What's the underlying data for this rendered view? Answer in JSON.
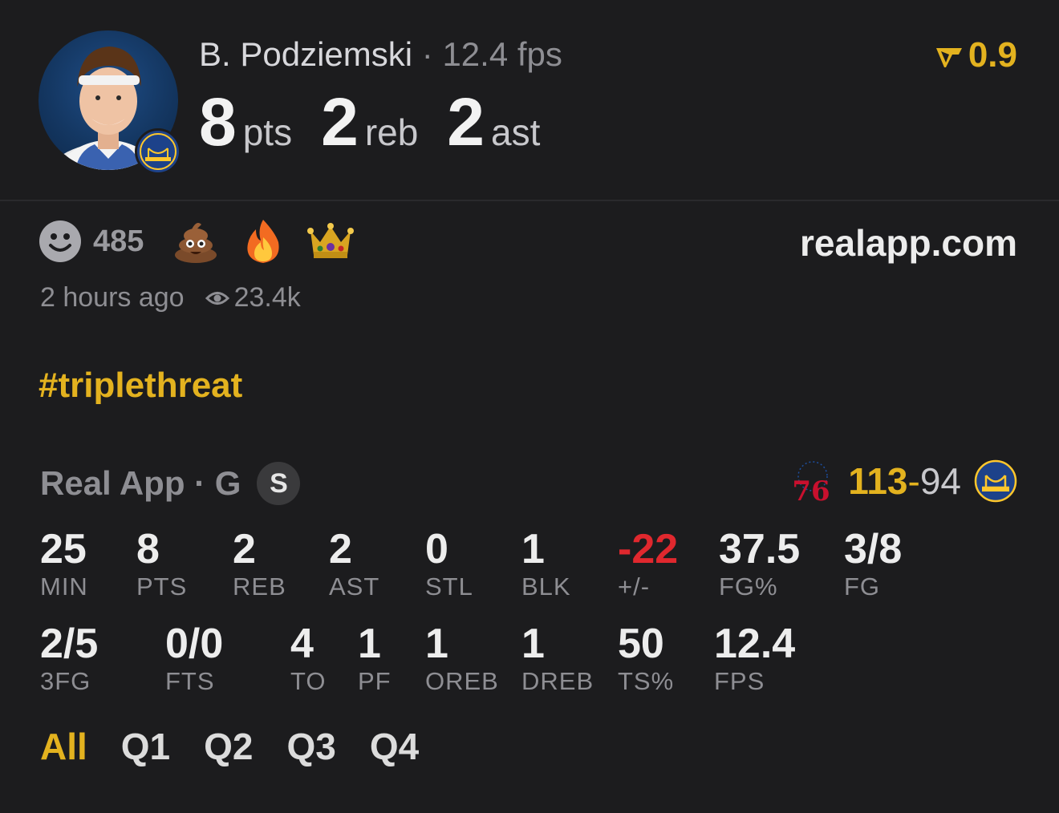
{
  "header": {
    "player_name": "B. Podziemski",
    "separator": "·",
    "fps_text": "12.4 fps",
    "rating_icon": "real-logo-icon",
    "rating": "0.9",
    "stats": [
      {
        "value": "8",
        "unit": "pts"
      },
      {
        "value": "2",
        "unit": "reb"
      },
      {
        "value": "2",
        "unit": "ast"
      }
    ]
  },
  "reactions": {
    "count": "485",
    "icons": [
      "smiley-icon",
      "poop-emoji-icon",
      "fire-emoji-icon",
      "crown-emoji-icon"
    ]
  },
  "site": "realapp.com",
  "meta": {
    "time_ago": "2 hours ago",
    "views": "23.4k"
  },
  "hashtag": "#triplethreat",
  "game": {
    "source": "Real App · G",
    "badge": "S",
    "home_score": "113",
    "dash": "-",
    "away_score": "94",
    "opponent_logo": "76",
    "colors": {
      "accent": "#e3b21f",
      "negative": "#e0282e",
      "muted": "#8e8e93"
    }
  },
  "stats_row1": [
    {
      "value": "25",
      "label": "MIN"
    },
    {
      "value": "8",
      "label": "PTS"
    },
    {
      "value": "2",
      "label": "REB"
    },
    {
      "value": "2",
      "label": "AST"
    },
    {
      "value": "0",
      "label": "STL"
    },
    {
      "value": "1",
      "label": "BLK"
    },
    {
      "value": "-22",
      "label": "+/-"
    },
    {
      "value": "37.5",
      "label": "FG%"
    },
    {
      "value": "3/8",
      "label": "FG"
    }
  ],
  "stats_row2": [
    {
      "value": "2/5",
      "label": "3FG"
    },
    {
      "value": "0/0",
      "label": "FTS"
    },
    {
      "value": "4",
      "label": "TO"
    },
    {
      "value": "1",
      "label": "PF"
    },
    {
      "value": "1",
      "label": "OREB"
    },
    {
      "value": "1",
      "label": "DREB"
    },
    {
      "value": "50",
      "label": "TS%"
    },
    {
      "value": "12.4",
      "label": "FPS"
    }
  ],
  "periods": [
    "All",
    "Q1",
    "Q2",
    "Q3",
    "Q4"
  ]
}
